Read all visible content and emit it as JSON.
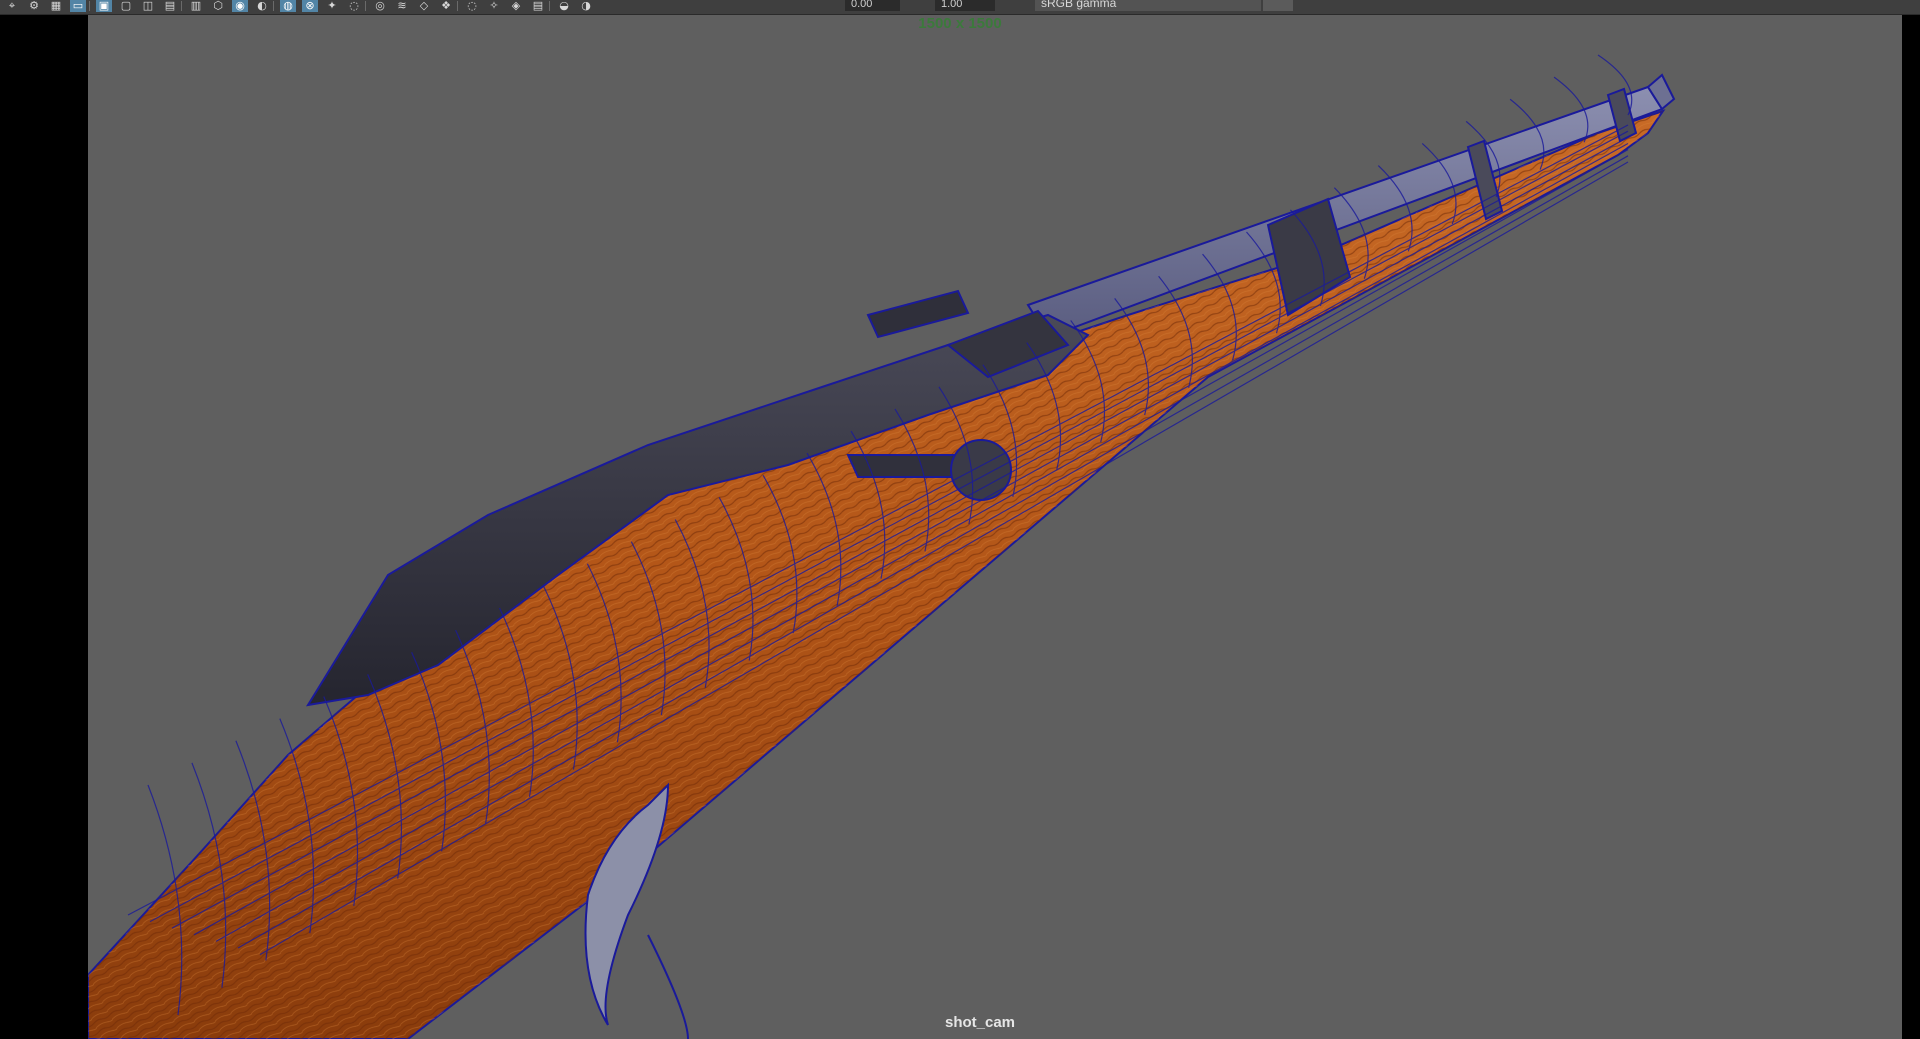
{
  "toolbar": {
    "icons": [
      "select-camera-icon",
      "camera-attributes-icon",
      "grid-icon",
      "film-gate-icon",
      "resolution-gate-icon",
      "gate-mask-icon",
      "field-chart-icon",
      "safe-action-icon",
      "safe-title-icon",
      "wireframe-icon",
      "smooth-shade-icon",
      "default-material-icon",
      "wireframe-on-shaded-icon",
      "xray-icon",
      "lights-icon",
      "shadows-icon",
      "ambient-occlusion-icon",
      "motion-blur-icon",
      "antialiasing-icon",
      "depth-of-field-icon",
      "isolate-select-icon",
      "xray-joints-icon",
      "xray-active-icon",
      "camera-exposure-icon",
      "exposure-icon",
      "gamma-icon"
    ],
    "exposure_value": "0.00",
    "gamma_value": "1.00",
    "view_transform": "sRGB gamma"
  },
  "viewport": {
    "resolution_label": "1500 x 1500",
    "camera_label": "shot_cam",
    "background_color": "#5f5f5f",
    "wireframe_color": "#1a1a9a",
    "wood_color": "#b85a1c",
    "metal_color": "#2b2b38"
  }
}
